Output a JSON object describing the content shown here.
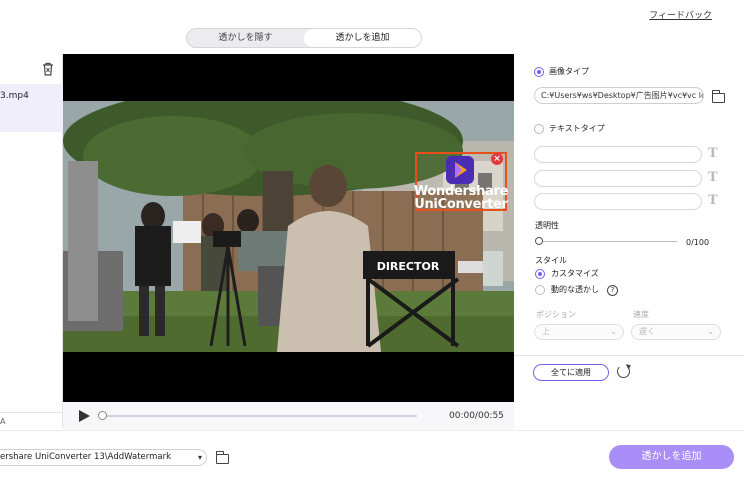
{
  "header": {
    "feedback_link": "フィードバック",
    "tabs": [
      {
        "label": "透かしを隠す",
        "active": false
      },
      {
        "label": "透かしを追加",
        "active": true
      }
    ]
  },
  "file_list": {
    "items": [
      {
        "name": "3.mp4"
      }
    ],
    "bottom_label": "A"
  },
  "player": {
    "watermark_text_line1": "Wondershare",
    "watermark_text_line2": "UniConverter",
    "close_glyph": "×",
    "current_time": "00:00/00:55"
  },
  "settings": {
    "image_type_label": "画像タイプ",
    "image_path": "C:¥Users¥ws¥Desktop¥广告图片¥vc¥vc lo",
    "text_type_label": "テキストタイプ",
    "text_format_glyph": "T",
    "opacity_label": "透明性",
    "opacity_value": "0/100",
    "style_label": "スタイル",
    "style_options": [
      {
        "label": "カスタマイズ",
        "selected": true
      },
      {
        "label": "動的な透かし",
        "selected": false
      }
    ],
    "help_glyph": "?",
    "position_label": "ポジション",
    "position_value": "上",
    "speed_label": "速度",
    "speed_value": "遅く",
    "apply_all_button": "全てに適用"
  },
  "footer": {
    "output_path": "ershare UniConverter 13\\AddWatermark",
    "add_watermark_button": "透かしを追加"
  },
  "colors": {
    "accent": "#7b5cf0",
    "primary_button": "#a98ef7",
    "watermark_border": "#e8501a",
    "close_badge": "#e4393c"
  }
}
